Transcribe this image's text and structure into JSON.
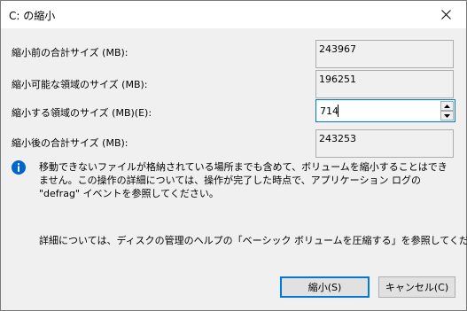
{
  "window": {
    "title": "C: の縮小"
  },
  "fields": {
    "total_before": {
      "label": "縮小前の合計サイズ (MB):",
      "value": "243967"
    },
    "available": {
      "label": "縮小可能な領域のサイズ (MB):",
      "value": "196251"
    },
    "shrink_amount": {
      "label": "縮小する領域のサイズ (MB)(E):",
      "value": "714"
    },
    "total_after": {
      "label": "縮小後の合計サイズ (MB):",
      "value": "243253"
    }
  },
  "info": {
    "icon": "info-icon",
    "text": "移動できないファイルが格納されている場所までも含めて、ボリュームを縮小することはできません。この操作の詳細については、操作が完了した時点で、アプリケーション ログの \"defrag\" イベントを参照してください。"
  },
  "help": {
    "text": "詳細については、ディスクの管理のヘルプの「ベーシック ボリュームを圧縮する」を参照してください"
  },
  "buttons": {
    "shrink_label": "縮小(S)",
    "cancel_label": "キャンセル(C)"
  },
  "colors": {
    "accent": "#0078d7",
    "info_icon": "#0066cc"
  }
}
